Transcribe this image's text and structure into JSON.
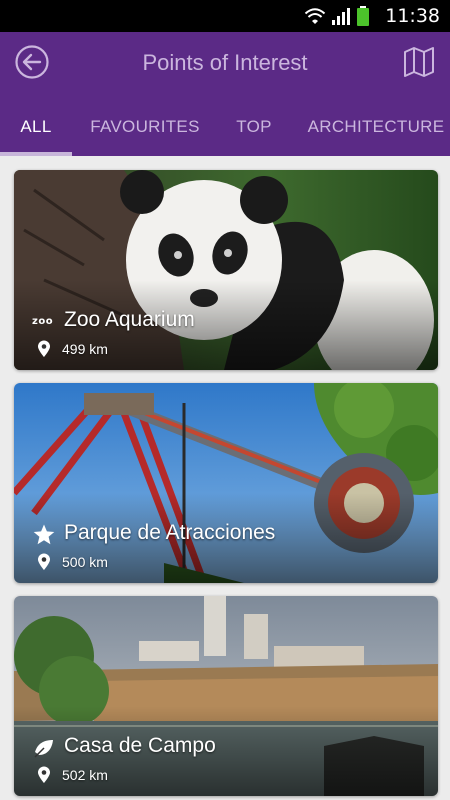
{
  "status_bar": {
    "time": "11:38"
  },
  "header": {
    "title": "Points of Interest"
  },
  "tabs": [
    {
      "label": "ALL",
      "active": true
    },
    {
      "label": "FAVOURITES",
      "active": false
    },
    {
      "label": "TOP",
      "active": false
    },
    {
      "label": "ARCHITECTURE",
      "active": false
    }
  ],
  "cards": [
    {
      "name": "Zoo Aquarium",
      "distance": "499 km",
      "category_icon": "zoo-icon",
      "category_text": "zoo"
    },
    {
      "name": "Parque de Atracciones",
      "distance": "500 km",
      "category_icon": "star-icon"
    },
    {
      "name": "Casa de Campo",
      "distance": "502 km",
      "category_icon": "leaf-icon"
    }
  ],
  "colors": {
    "app_bar": "#5b2a86",
    "tab_indicator": "#c7b5d9",
    "background": "#ececec"
  }
}
